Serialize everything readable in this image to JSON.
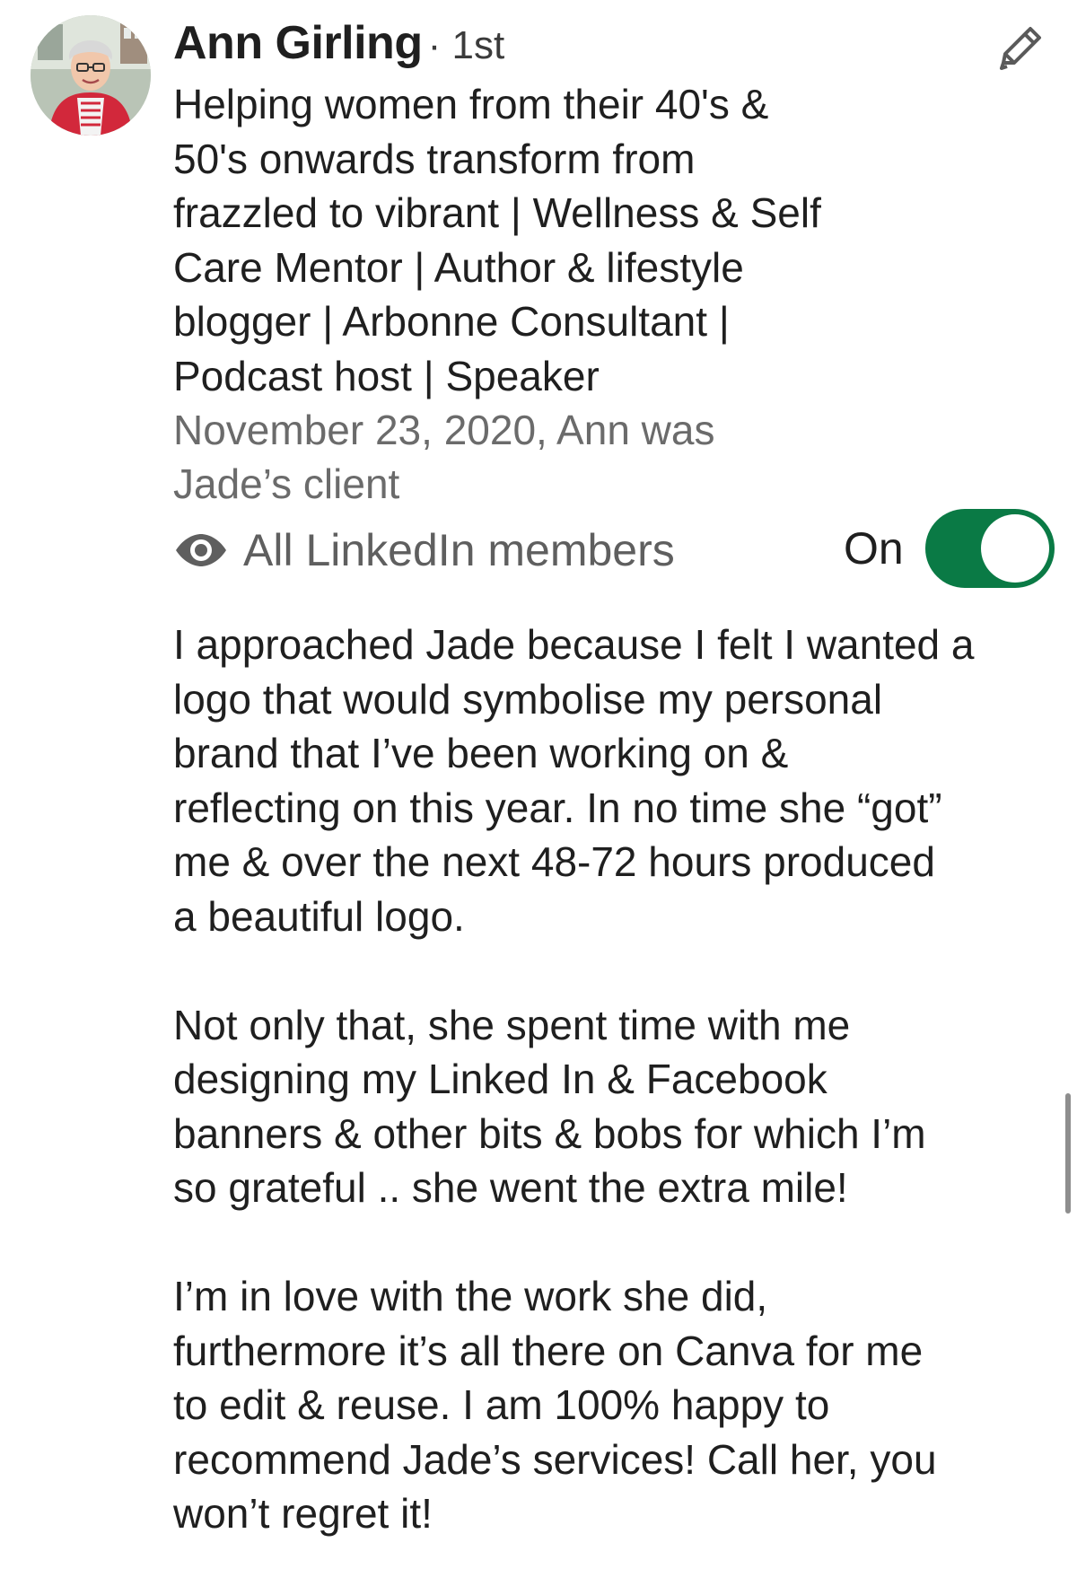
{
  "author": {
    "name": "Ann Girling",
    "degree": "· 1st",
    "headline_lines": [
      "Helping women from their 40's &",
      "50's onwards transform from",
      "frazzled to vibrant | Wellness & Self",
      "Care Mentor | Author & lifestyle",
      "blogger | Arbonne Consultant |",
      "Podcast host | Speaker"
    ],
    "meta_lines": [
      "November 23, 2020, Ann was",
      "Jade’s client"
    ]
  },
  "visibility": {
    "icon": "eye-icon",
    "label": "All LinkedIn members",
    "toggle_label": "On",
    "toggle_on": true
  },
  "recommendation": {
    "paragraphs": [
      [
        "I approached Jade because I felt I wanted a",
        "logo that would symbolise my personal",
        "brand that I’ve been working on &",
        "reflecting on this year. In no time she “got”",
        "me & over the next 48-72 hours produced",
        "a beautiful logo."
      ],
      [
        "Not only that, she spent time with me",
        "designing my Linked In & Facebook",
        "banners & other bits & bobs for which I’m",
        "so grateful .. she went the extra mile!"
      ],
      [
        "I’m in love with the work she did,",
        "furthermore it’s all there on Canva for me",
        "to edit & reuse. I am 100% happy to",
        "recommend Jade’s services! Call her, you",
        "won’t regret it!"
      ]
    ]
  },
  "icons": {
    "edit": "pencil-icon",
    "avatar": "profile-photo"
  },
  "colors": {
    "toggle_on": "#0a7a45",
    "meta_text": "#6b6b6b",
    "body_text": "#1f1f1f"
  }
}
